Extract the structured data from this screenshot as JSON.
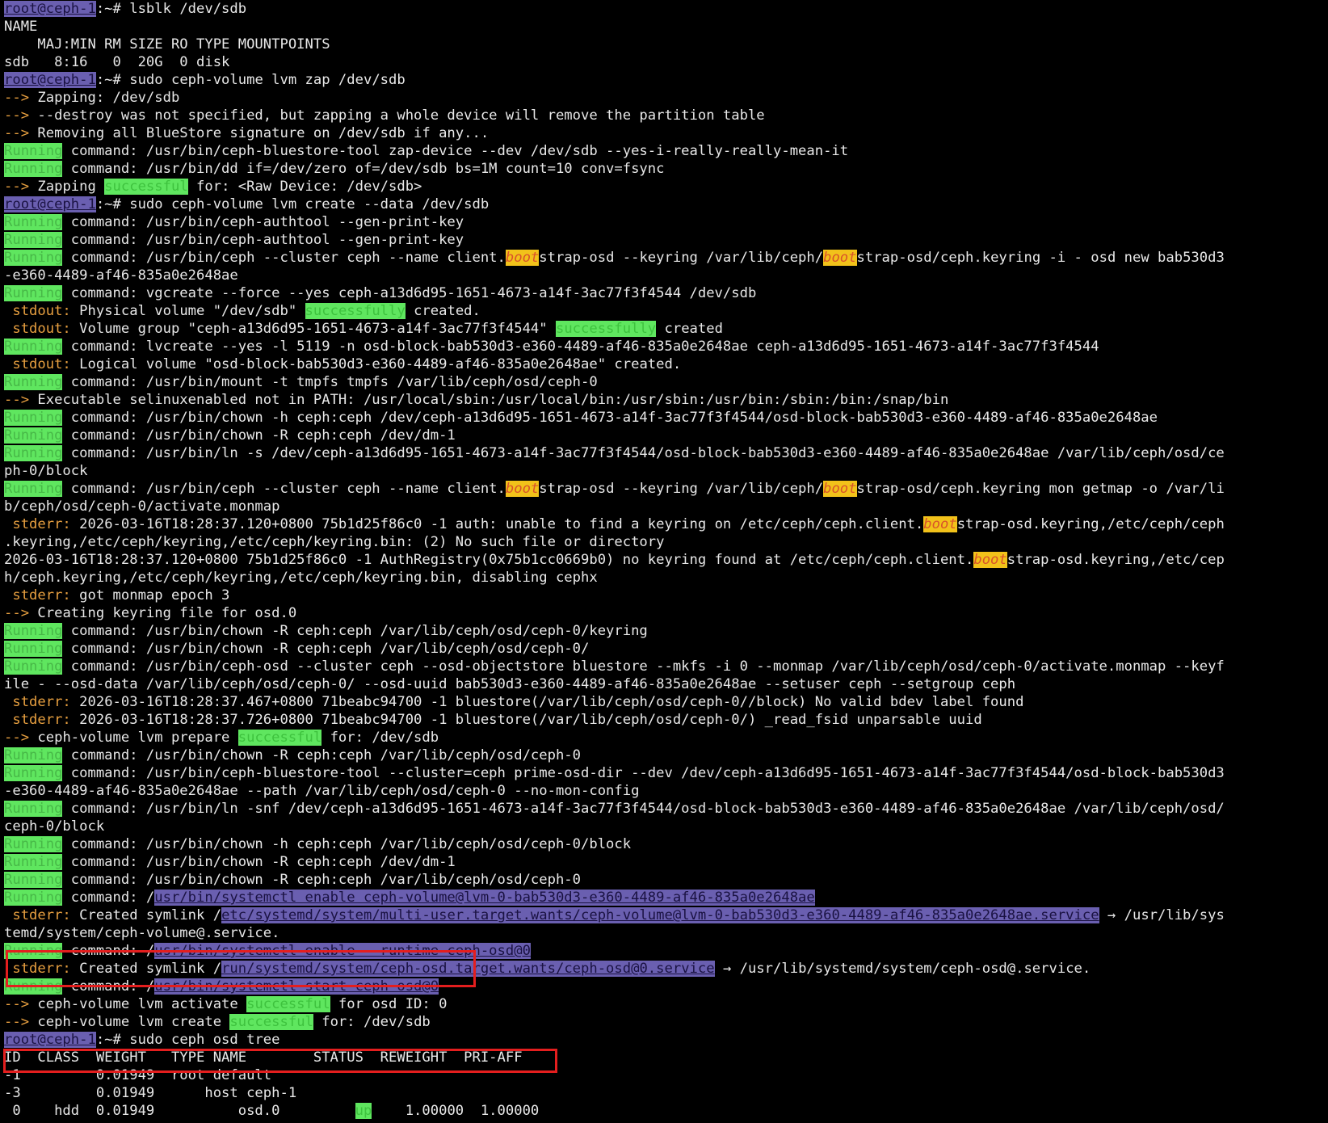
{
  "prompt": {
    "host": "root@ceph-1",
    "suffix": ":~# "
  },
  "tokens": {
    "running": "Running",
    "arrow": "-->",
    "stdout": " stdout:",
    "stderr": " stderr:",
    "successful": "successful",
    "successfully": "successfully",
    "boot": "boot",
    "up": "up"
  },
  "colors": {
    "background": "#000000",
    "text": "#e8e8e8",
    "host_highlight": "#6a5fb0",
    "running_highlight": "#5fe65f",
    "success_highlight": "#5fe65f",
    "boot_highlight": "#f2c21a",
    "stream_label": "#e8a040",
    "annotation_box": "#e41e1e"
  },
  "lines": [
    [
      {
        "t": "host",
        "k": "prompt.host"
      },
      {
        "k": "prompt.suffix"
      },
      "lsblk /dev/sdb"
    ],
    [
      "NAME"
    ],
    [
      "    MAJ:MIN RM SIZE RO TYPE MOUNTPOINTS"
    ],
    [
      "sdb   8:16   0  20G  0 disk"
    ],
    [
      {
        "t": "host",
        "k": "prompt.host"
      },
      {
        "k": "prompt.suffix"
      },
      "sudo ceph-volume lvm zap /dev/sdb"
    ],
    [
      {
        "t": "arrow",
        "k": "tokens.arrow"
      },
      " Zapping: /dev/sdb"
    ],
    [
      {
        "t": "arrow",
        "k": "tokens.arrow"
      },
      " --destroy was not specified, but zapping a whole device will remove the partition table"
    ],
    [
      {
        "t": "arrow",
        "k": "tokens.arrow"
      },
      " Removing all BlueStore signature on /dev/sdb if any..."
    ],
    [
      {
        "t": "run",
        "k": "tokens.running"
      },
      " command: /usr/bin/ceph-bluestore-tool zap-device --dev /dev/sdb --yes-i-really-really-mean-it"
    ],
    [
      {
        "t": "run",
        "k": "tokens.running"
      },
      " command: /usr/bin/dd if=/dev/zero of=/dev/sdb bs=1M count=10 conv=fsync"
    ],
    [
      {
        "t": "arrow",
        "k": "tokens.arrow"
      },
      " Zapping ",
      {
        "t": "succ",
        "k": "tokens.successful"
      },
      " for: <Raw Device: /dev/sdb>"
    ],
    [
      {
        "t": "host",
        "k": "prompt.host"
      },
      {
        "k": "prompt.suffix"
      },
      "sudo ceph-volume lvm create --data /dev/sdb"
    ],
    [
      {
        "t": "run",
        "k": "tokens.running"
      },
      " command: /usr/bin/ceph-authtool --gen-print-key"
    ],
    [
      {
        "t": "run",
        "k": "tokens.running"
      },
      " command: /usr/bin/ceph-authtool --gen-print-key"
    ],
    [
      {
        "t": "run",
        "k": "tokens.running"
      },
      " command: /usr/bin/ceph --cluster ceph --name client.",
      {
        "t": "boot",
        "k": "tokens.boot"
      },
      "strap-osd --keyring /var/lib/ceph/",
      {
        "t": "boot",
        "k": "tokens.boot"
      },
      "strap-osd/ceph.keyring -i - osd new bab530d3"
    ],
    [
      "-e360-4489-af46-835a0e2648ae"
    ],
    [
      {
        "t": "run",
        "k": "tokens.running"
      },
      " command: vgcreate --force --yes ceph-a13d6d95-1651-4673-a14f-3ac77f3f4544 /dev/sdb"
    ],
    [
      {
        "t": "stream",
        "k": "tokens.stdout"
      },
      " Physical volume \"/dev/sdb\" ",
      {
        "t": "succ",
        "k": "tokens.successfully"
      },
      " created."
    ],
    [
      {
        "t": "stream",
        "k": "tokens.stdout"
      },
      " Volume group \"ceph-a13d6d95-1651-4673-a14f-3ac77f3f4544\" ",
      {
        "t": "succ",
        "k": "tokens.successfully"
      },
      " created"
    ],
    [
      {
        "t": "run",
        "k": "tokens.running"
      },
      " command: lvcreate --yes -l 5119 -n osd-block-bab530d3-e360-4489-af46-835a0e2648ae ceph-a13d6d95-1651-4673-a14f-3ac77f3f4544"
    ],
    [
      {
        "t": "stream",
        "k": "tokens.stdout"
      },
      " Logical volume \"osd-block-bab530d3-e360-4489-af46-835a0e2648ae\" created."
    ],
    [
      {
        "t": "run",
        "k": "tokens.running"
      },
      " command: /usr/bin/mount -t tmpfs tmpfs /var/lib/ceph/osd/ceph-0"
    ],
    [
      {
        "t": "arrow",
        "k": "tokens.arrow"
      },
      " Executable selinuxenabled not in PATH: /usr/local/sbin:/usr/local/bin:/usr/sbin:/usr/bin:/sbin:/bin:/snap/bin"
    ],
    [
      {
        "t": "run",
        "k": "tokens.running"
      },
      " command: /usr/bin/chown -h ceph:ceph /dev/ceph-a13d6d95-1651-4673-a14f-3ac77f3f4544/osd-block-bab530d3-e360-4489-af46-835a0e2648ae"
    ],
    [
      {
        "t": "run",
        "k": "tokens.running"
      },
      " command: /usr/bin/chown -R ceph:ceph /dev/dm-1"
    ],
    [
      {
        "t": "run",
        "k": "tokens.running"
      },
      " command: /usr/bin/ln -s /dev/ceph-a13d6d95-1651-4673-a14f-3ac77f3f4544/osd-block-bab530d3-e360-4489-af46-835a0e2648ae /var/lib/ceph/osd/ce"
    ],
    [
      "ph-0/block"
    ],
    [
      {
        "t": "run",
        "k": "tokens.running"
      },
      " command: /usr/bin/ceph --cluster ceph --name client.",
      {
        "t": "boot",
        "k": "tokens.boot"
      },
      "strap-osd --keyring /var/lib/ceph/",
      {
        "t": "boot",
        "k": "tokens.boot"
      },
      "strap-osd/ceph.keyring mon getmap -o /var/li"
    ],
    [
      "b/ceph/osd/ceph-0/activate.monmap"
    ],
    [
      {
        "t": "stream",
        "k": "tokens.stderr"
      },
      " 2026-03-16T18:28:37.120+0800 75b1d25f86c0 -1 auth: unable to find a keyring on /etc/ceph/ceph.client.",
      {
        "t": "boot",
        "k": "tokens.boot"
      },
      "strap-osd.keyring,/etc/ceph/ceph"
    ],
    [
      ".keyring,/etc/ceph/keyring,/etc/ceph/keyring.bin: (2) No such file or directory"
    ],
    [
      "2026-03-16T18:28:37.120+0800 75b1d25f86c0 -1 AuthRegistry(0x75b1cc0669b0) no keyring found at /etc/ceph/ceph.client.",
      {
        "t": "boot",
        "k": "tokens.boot"
      },
      "strap-osd.keyring,/etc/cep"
    ],
    [
      "h/ceph.keyring,/etc/ceph/keyring,/etc/ceph/keyring.bin, disabling cephx"
    ],
    [
      {
        "t": "stream",
        "k": "tokens.stderr"
      },
      " got monmap epoch 3"
    ],
    [
      {
        "t": "arrow",
        "k": "tokens.arrow"
      },
      " Creating keyring file for osd.0"
    ],
    [
      {
        "t": "run",
        "k": "tokens.running"
      },
      " command: /usr/bin/chown -R ceph:ceph /var/lib/ceph/osd/ceph-0/keyring"
    ],
    [
      {
        "t": "run",
        "k": "tokens.running"
      },
      " command: /usr/bin/chown -R ceph:ceph /var/lib/ceph/osd/ceph-0/"
    ],
    [
      {
        "t": "run",
        "k": "tokens.running"
      },
      " command: /usr/bin/ceph-osd --cluster ceph --osd-objectstore bluestore --mkfs -i 0 --monmap /var/lib/ceph/osd/ceph-0/activate.monmap --keyf"
    ],
    [
      "ile - --osd-data /var/lib/ceph/osd/ceph-0/ --osd-uuid bab530d3-e360-4489-af46-835a0e2648ae --setuser ceph --setgroup ceph"
    ],
    [
      {
        "t": "stream",
        "k": "tokens.stderr"
      },
      " 2026-03-16T18:28:37.467+0800 71beabc94700 -1 bluestore(/var/lib/ceph/osd/ceph-0//block) No valid bdev label found"
    ],
    [
      {
        "t": "stream",
        "k": "tokens.stderr"
      },
      " 2026-03-16T18:28:37.726+0800 71beabc94700 -1 bluestore(/var/lib/ceph/osd/ceph-0/) _read_fsid unparsable uuid"
    ],
    [
      {
        "t": "arrow",
        "k": "tokens.arrow"
      },
      " ceph-volume lvm prepare ",
      {
        "t": "succ",
        "k": "tokens.successful"
      },
      " for: /dev/sdb"
    ],
    [
      {
        "t": "run",
        "k": "tokens.running"
      },
      " command: /usr/bin/chown -R ceph:ceph /var/lib/ceph/osd/ceph-0"
    ],
    [
      {
        "t": "run",
        "k": "tokens.running"
      },
      " command: /usr/bin/ceph-bluestore-tool --cluster=ceph prime-osd-dir --dev /dev/ceph-a13d6d95-1651-4673-a14f-3ac77f3f4544/osd-block-bab530d3"
    ],
    [
      "-e360-4489-af46-835a0e2648ae --path /var/lib/ceph/osd/ceph-0 --no-mon-config"
    ],
    [
      {
        "t": "run",
        "k": "tokens.running"
      },
      " command: /usr/bin/ln -snf /dev/ceph-a13d6d95-1651-4673-a14f-3ac77f3f4544/osd-block-bab530d3-e360-4489-af46-835a0e2648ae /var/lib/ceph/osd/"
    ],
    [
      "ceph-0/block"
    ],
    [
      {
        "t": "run",
        "k": "tokens.running"
      },
      " command: /usr/bin/chown -h ceph:ceph /var/lib/ceph/osd/ceph-0/block"
    ],
    [
      {
        "t": "run",
        "k": "tokens.running"
      },
      " command: /usr/bin/chown -R ceph:ceph /dev/dm-1"
    ],
    [
      {
        "t": "run",
        "k": "tokens.running"
      },
      " command: /usr/bin/chown -R ceph:ceph /var/lib/ceph/osd/ceph-0"
    ],
    [
      {
        "t": "run",
        "k": "tokens.running"
      },
      " command: /",
      {
        "t": "link",
        "v": "usr/bin/systemctl enable ceph-volume@lvm-0-bab530d3-e360-4489-af46-835a0e2648ae"
      }
    ],
    [
      {
        "t": "stream",
        "k": "tokens.stderr"
      },
      " Created symlink /",
      {
        "t": "link",
        "v": "etc/systemd/system/multi-user.target.wants/ceph-volume@lvm-0-bab530d3-e360-4489-af46-835a0e2648ae.service"
      },
      " → /usr/lib/sys"
    ],
    [
      "temd/system/ceph-volume@.service."
    ],
    [
      {
        "t": "run",
        "k": "tokens.running"
      },
      " command: /",
      {
        "t": "link",
        "v": "usr/bin/systemctl enable --runtime ceph-osd@0"
      }
    ],
    [
      {
        "t": "stream",
        "k": "tokens.stderr"
      },
      " Created symlink /",
      {
        "t": "link",
        "v": "run/systemd/system/ceph-osd.target.wants/ceph-osd@0.service"
      },
      " → /usr/lib/systemd/system/ceph-osd@.service."
    ],
    [
      {
        "t": "run",
        "k": "tokens.running"
      },
      " command: /",
      {
        "t": "link",
        "v": "usr/bin/systemctl start ceph-osd@0"
      }
    ],
    [
      {
        "t": "arrow",
        "k": "tokens.arrow"
      },
      " ceph-volume lvm activate ",
      {
        "t": "succ",
        "k": "tokens.successful"
      },
      " for osd ID: 0"
    ],
    [
      {
        "t": "arrow",
        "k": "tokens.arrow"
      },
      " ceph-volume lvm create ",
      {
        "t": "succ",
        "k": "tokens.successful"
      },
      " for: /dev/sdb"
    ],
    [
      {
        "t": "host",
        "k": "prompt.host"
      },
      {
        "k": "prompt.suffix"
      },
      "sudo ceph osd tree"
    ],
    [
      "ID  CLASS  WEIGHT   TYPE NAME        STATUS  REWEIGHT  PRI-AFF"
    ],
    [
      "-1         0.01949  root default"
    ],
    [
      "-3         0.01949      host ceph-1"
    ],
    [
      " 0    hdd  0.01949          osd.0         ",
      {
        "t": "up",
        "k": "tokens.up"
      },
      "    1.00000  1.00000"
    ]
  ]
}
